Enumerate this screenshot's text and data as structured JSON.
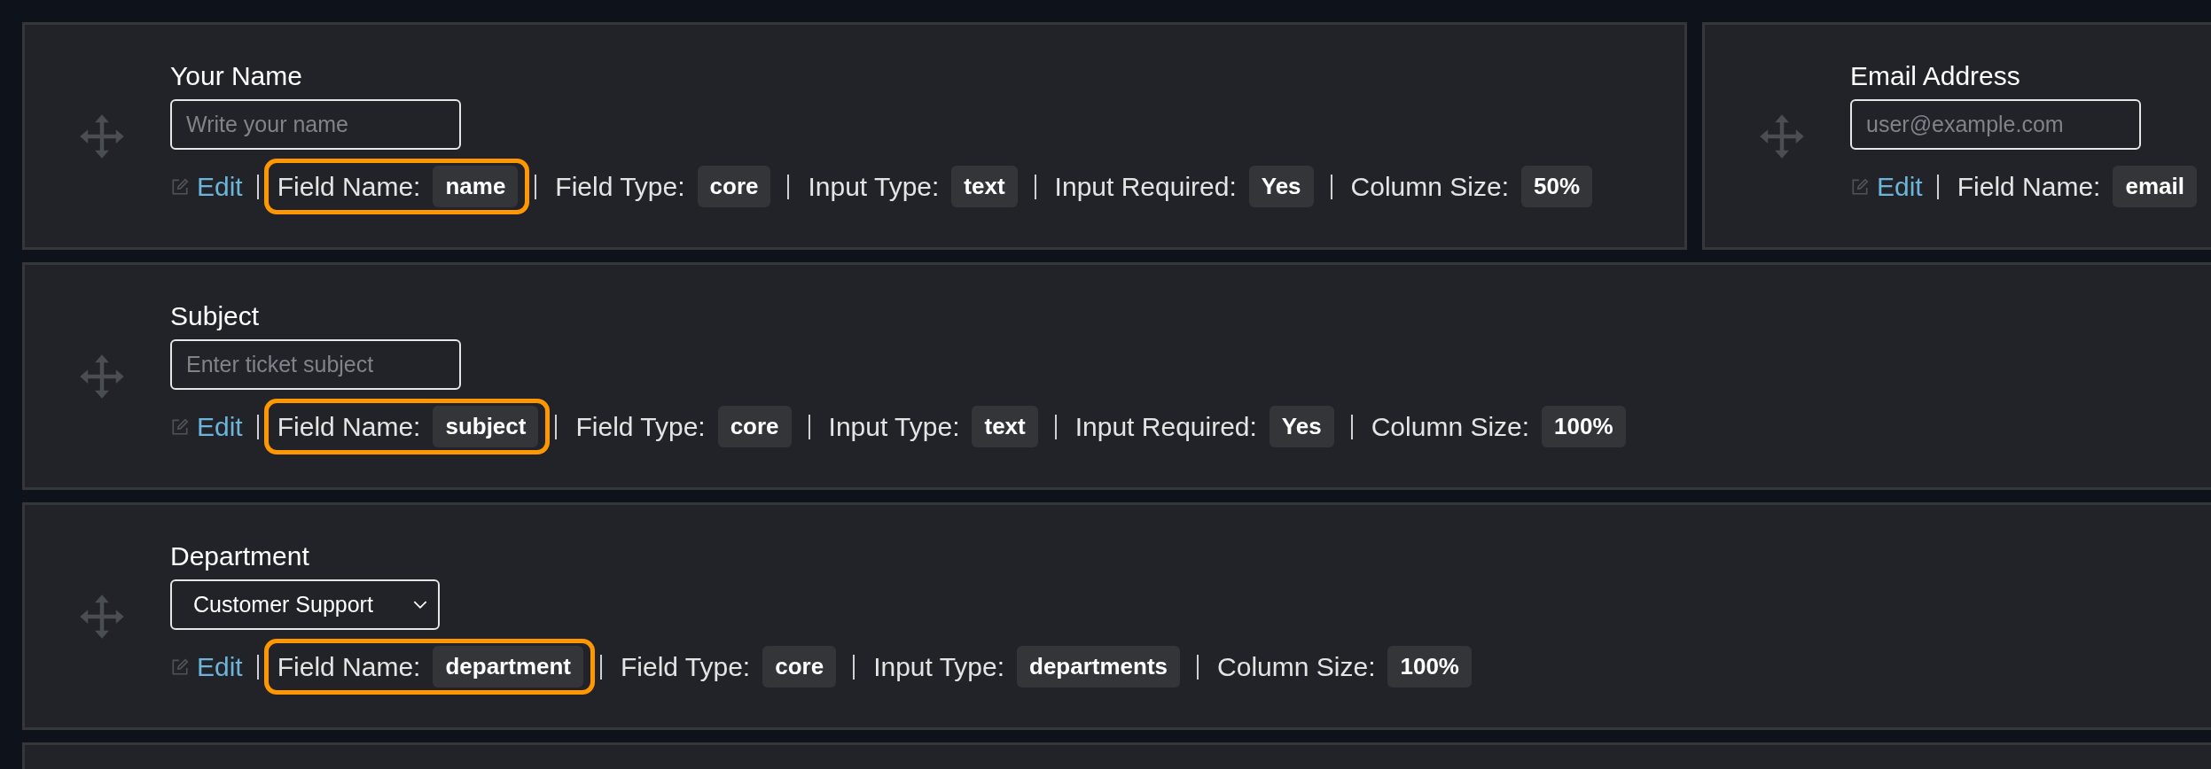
{
  "rows": [
    {
      "fields": [
        {
          "label": "Your Name",
          "kind": "text",
          "placeholder": "Write your name",
          "edit": "Edit",
          "meta": [
            {
              "label": "Field Name:",
              "value": "name",
              "highlighted": true
            },
            {
              "label": "Field Type:",
              "value": "core",
              "highlighted": false
            },
            {
              "label": "Input Type:",
              "value": "text",
              "highlighted": false
            },
            {
              "label": "Input Required:",
              "value": "Yes",
              "highlighted": false
            },
            {
              "label": "Column Size:",
              "value": "50%",
              "highlighted": false
            }
          ]
        },
        {
          "label": "Email Address",
          "kind": "text",
          "placeholder": "user@example.com",
          "edit": "Edit",
          "meta": [
            {
              "label": "Field Name:",
              "value": "email",
              "highlighted": false
            }
          ]
        }
      ]
    },
    {
      "fields": [
        {
          "label": "Subject",
          "kind": "text",
          "placeholder": "Enter ticket subject",
          "edit": "Edit",
          "meta": [
            {
              "label": "Field Name:",
              "value": "subject",
              "highlighted": true
            },
            {
              "label": "Field Type:",
              "value": "core",
              "highlighted": false
            },
            {
              "label": "Input Type:",
              "value": "text",
              "highlighted": false
            },
            {
              "label": "Input Required:",
              "value": "Yes",
              "highlighted": false
            },
            {
              "label": "Column Size:",
              "value": "100%",
              "highlighted": false
            }
          ]
        }
      ]
    },
    {
      "fields": [
        {
          "label": "Department",
          "kind": "select",
          "value": "Customer Support",
          "edit": "Edit",
          "meta": [
            {
              "label": "Field Name:",
              "value": "department",
              "highlighted": true
            },
            {
              "label": "Field Type:",
              "value": "core",
              "highlighted": false
            },
            {
              "label": "Input Type:",
              "value": "departments",
              "highlighted": false
            },
            {
              "label": "Column Size:",
              "value": "100%",
              "highlighted": false
            }
          ]
        }
      ]
    }
  ]
}
